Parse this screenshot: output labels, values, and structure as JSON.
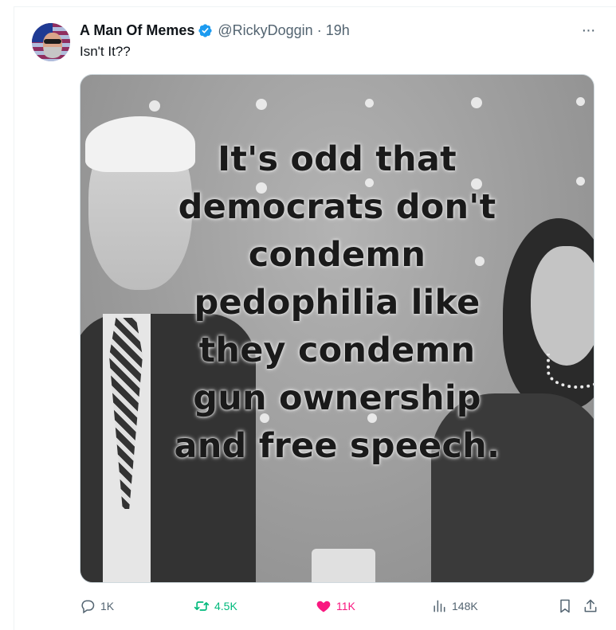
{
  "tweet": {
    "author_name": "A Man Of Memes",
    "handle": "@RickyDoggin",
    "separator": "·",
    "time": "19h",
    "text": "Isn't It??",
    "more_label": "···"
  },
  "media": {
    "caption_lines": [
      "It's odd that",
      "democrats don't",
      "condemn",
      "pedophilia like",
      "they condemn",
      "gun ownership",
      "and free speech."
    ]
  },
  "actions": {
    "reply_count": "1K",
    "retweet_count": "4.5K",
    "like_count": "11K",
    "views_count": "148K"
  },
  "colors": {
    "verified_blue": "#1d9bf0",
    "retweet_green": "#00ba7c",
    "like_pink": "#f91880",
    "secondary_text": "#536471"
  },
  "icons": [
    "verified-badge-icon",
    "more-icon",
    "reply-icon",
    "retweet-icon",
    "like-icon",
    "views-icon",
    "bookmark-icon",
    "share-icon"
  ]
}
